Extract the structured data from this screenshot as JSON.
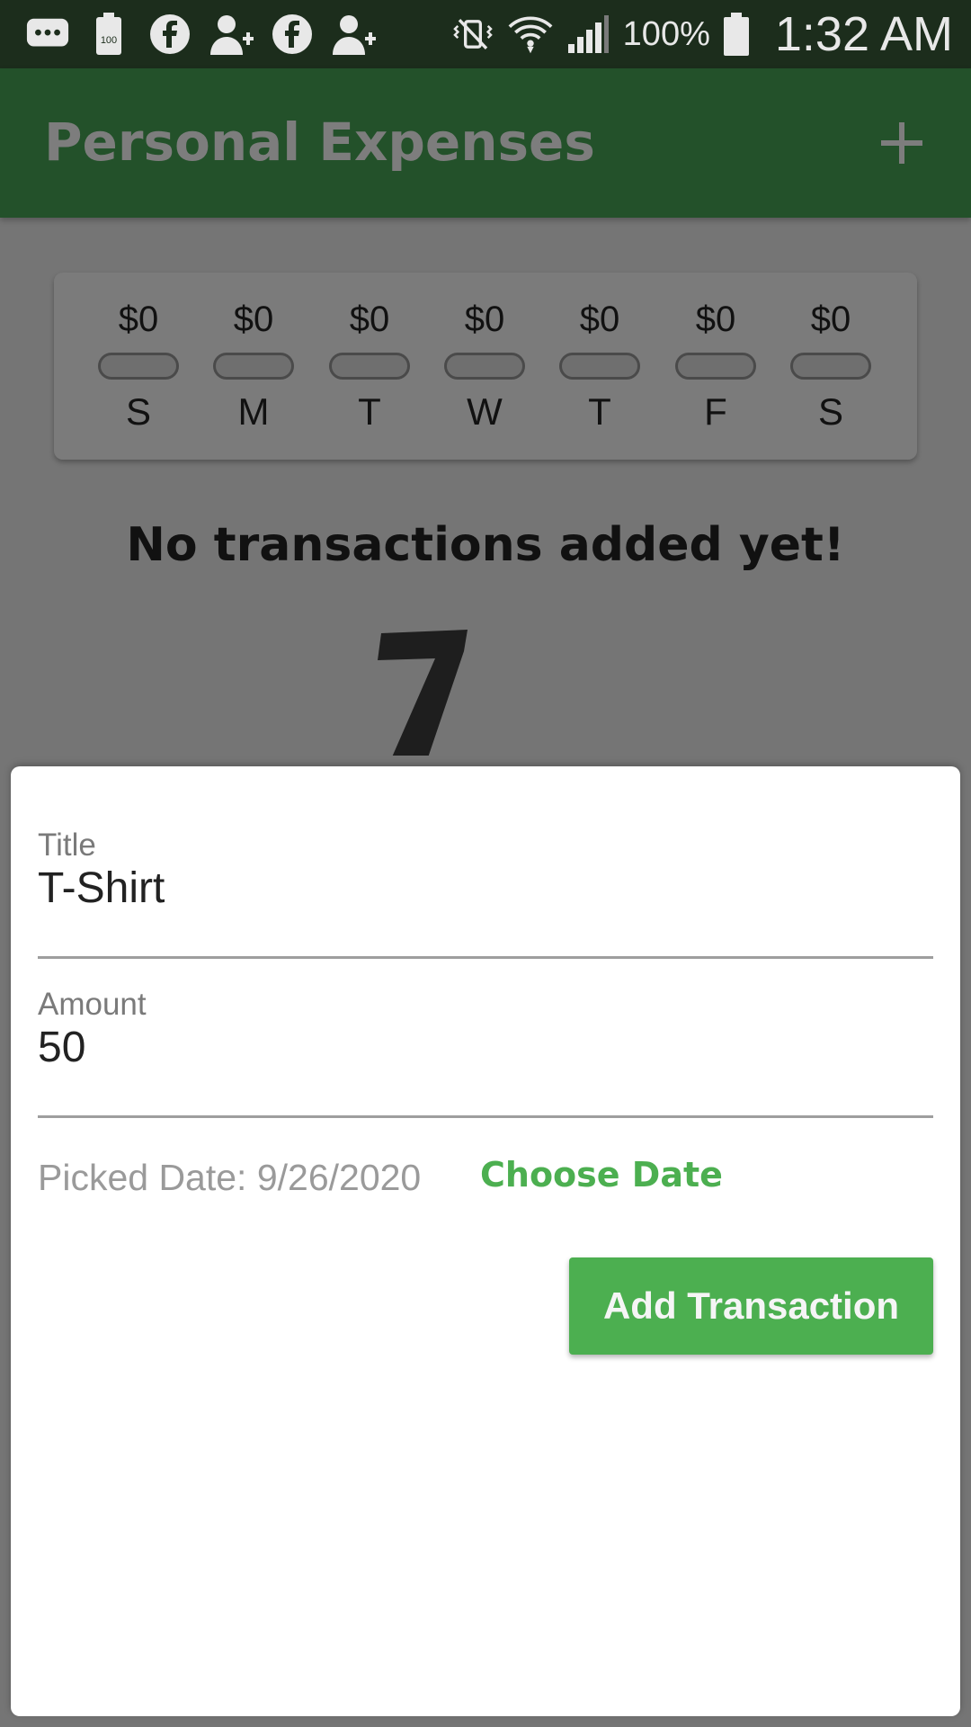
{
  "status_bar": {
    "battery_percent": "100%",
    "time": "1:32 AM",
    "icons": [
      "message-icon",
      "battery-saver-icon",
      "facebook-icon",
      "add-contact-icon",
      "facebook-icon",
      "add-contact-icon",
      "vibrate-mute-icon",
      "wifi-icon",
      "signal-icon",
      "battery-icon"
    ]
  },
  "app_bar": {
    "title": "Personal Expenses",
    "add_icon": "plus-icon",
    "color": "#2e7d32"
  },
  "chart": {
    "days": [
      {
        "label": "S",
        "amount": "$0",
        "fill_fraction": 0
      },
      {
        "label": "M",
        "amount": "$0",
        "fill_fraction": 0
      },
      {
        "label": "T",
        "amount": "$0",
        "fill_fraction": 0
      },
      {
        "label": "W",
        "amount": "$0",
        "fill_fraction": 0
      },
      {
        "label": "T",
        "amount": "$0",
        "fill_fraction": 0
      },
      {
        "label": "F",
        "amount": "$0",
        "fill_fraction": 0
      },
      {
        "label": "S",
        "amount": "$0",
        "fill_fraction": 0
      }
    ]
  },
  "empty_state": {
    "message": "No transactions added yet!",
    "image": "waiting-illustration"
  },
  "form": {
    "title_label": "Title",
    "title_value": "T-Shirt",
    "amount_label": "Amount",
    "amount_value": "50",
    "picked_date": "Picked Date: 9/26/2020",
    "choose_date_label": "Choose Date",
    "submit_label": "Add Transaction"
  },
  "colors": {
    "primary": "#2e7d32",
    "accent": "#4caf50"
  }
}
